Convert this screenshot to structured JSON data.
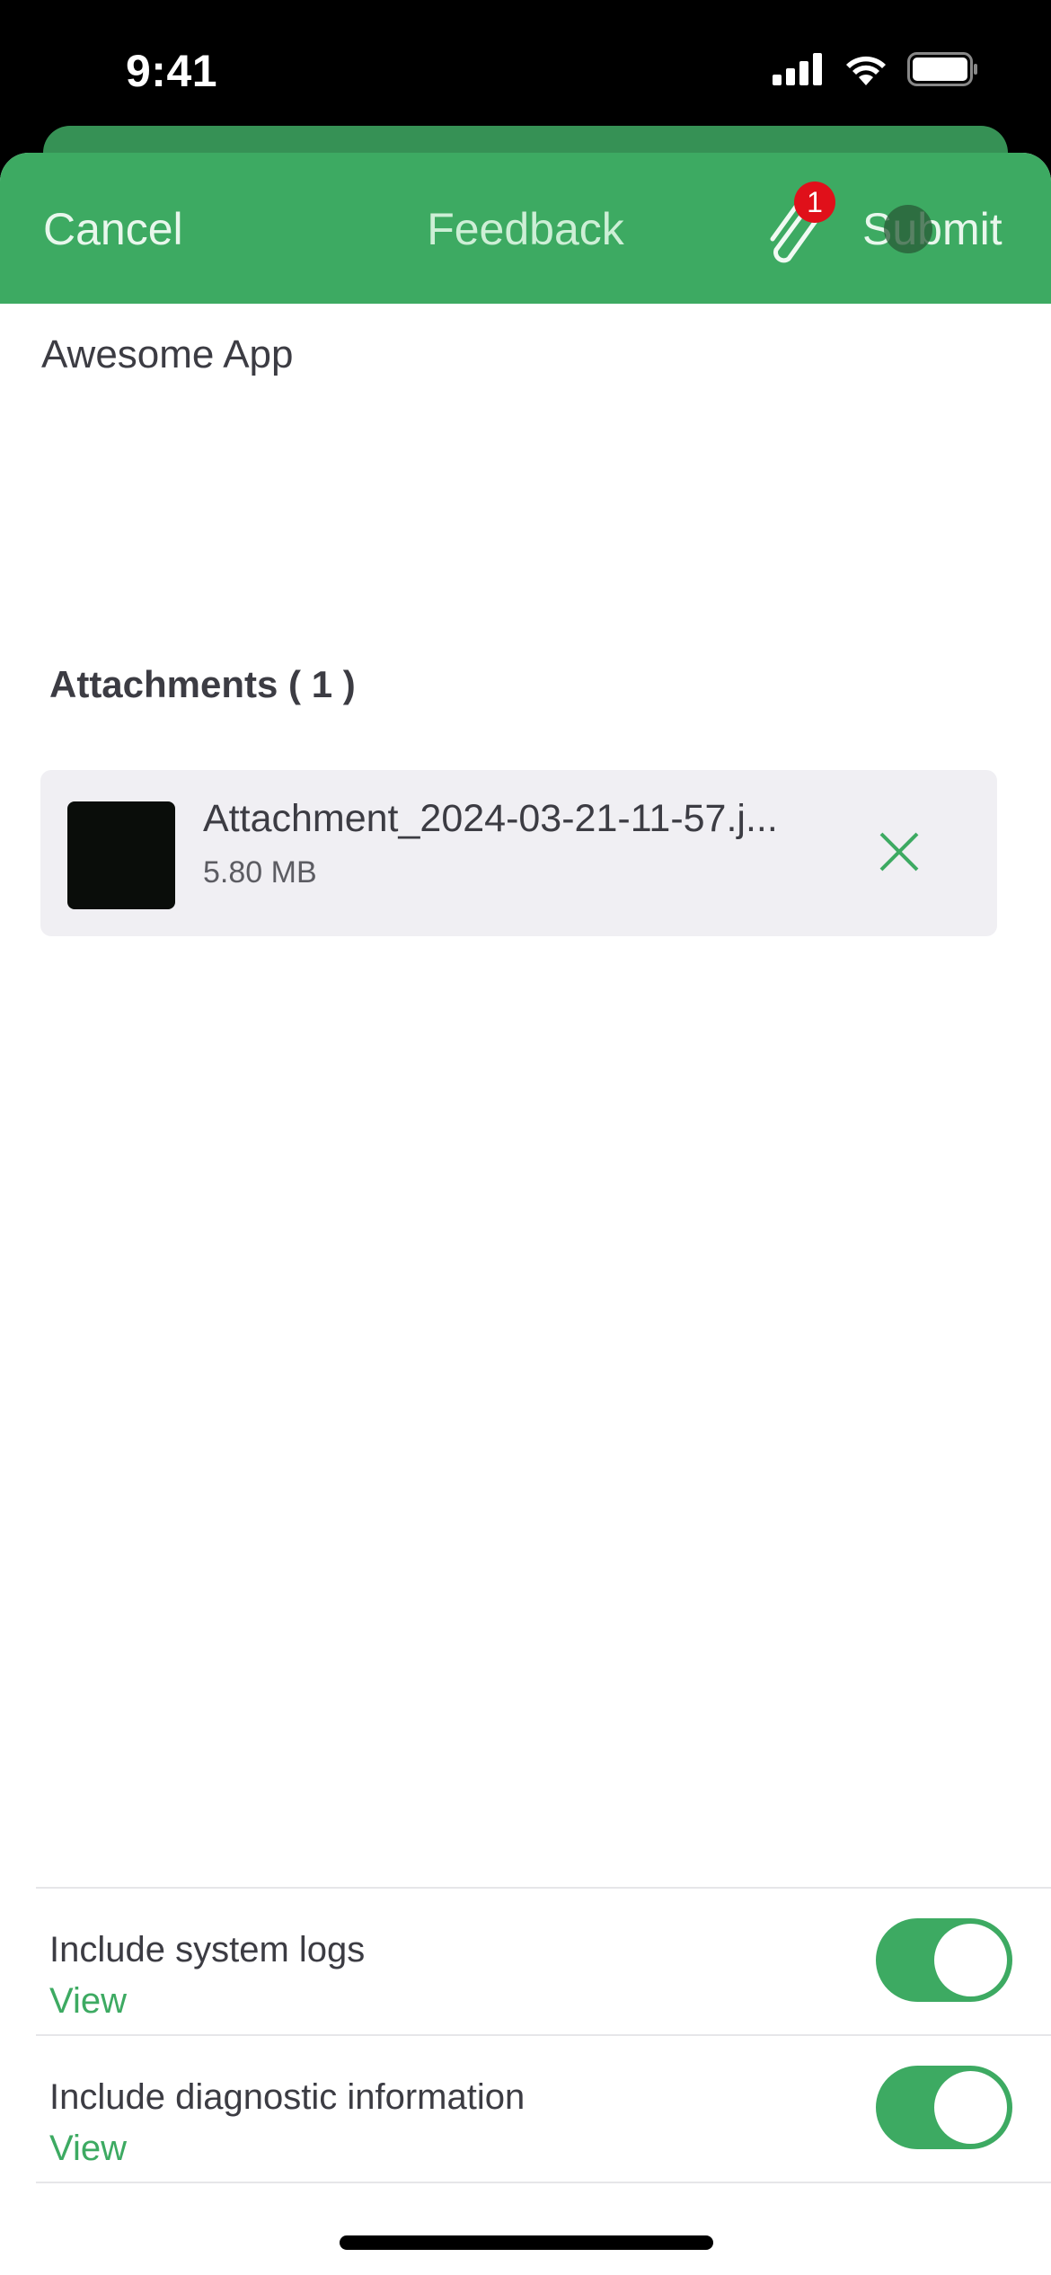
{
  "status_bar": {
    "time": "9:41",
    "icons": [
      "cellular-signal-icon",
      "wifi-icon",
      "battery-icon"
    ]
  },
  "navbar": {
    "cancel_label": "Cancel",
    "title": "Feedback",
    "attachment_icon": "paperclip-icon",
    "attachment_badge": "1",
    "submit_label": "Submit",
    "accent_color": "#3DAA62",
    "badge_color": "#E0101A"
  },
  "form": {
    "app_name": "Awesome App"
  },
  "attachments": {
    "title": "Attachments ( 1 )",
    "items": [
      {
        "file_name": "Attachment_2024-03-21-11-57.j...",
        "file_size": "5.80 MB",
        "remove_icon": "close-icon"
      }
    ]
  },
  "options": [
    {
      "label": "Include system logs",
      "link": "View",
      "enabled": true
    },
    {
      "label": "Include diagnostic information",
      "link": "View",
      "enabled": true
    }
  ]
}
